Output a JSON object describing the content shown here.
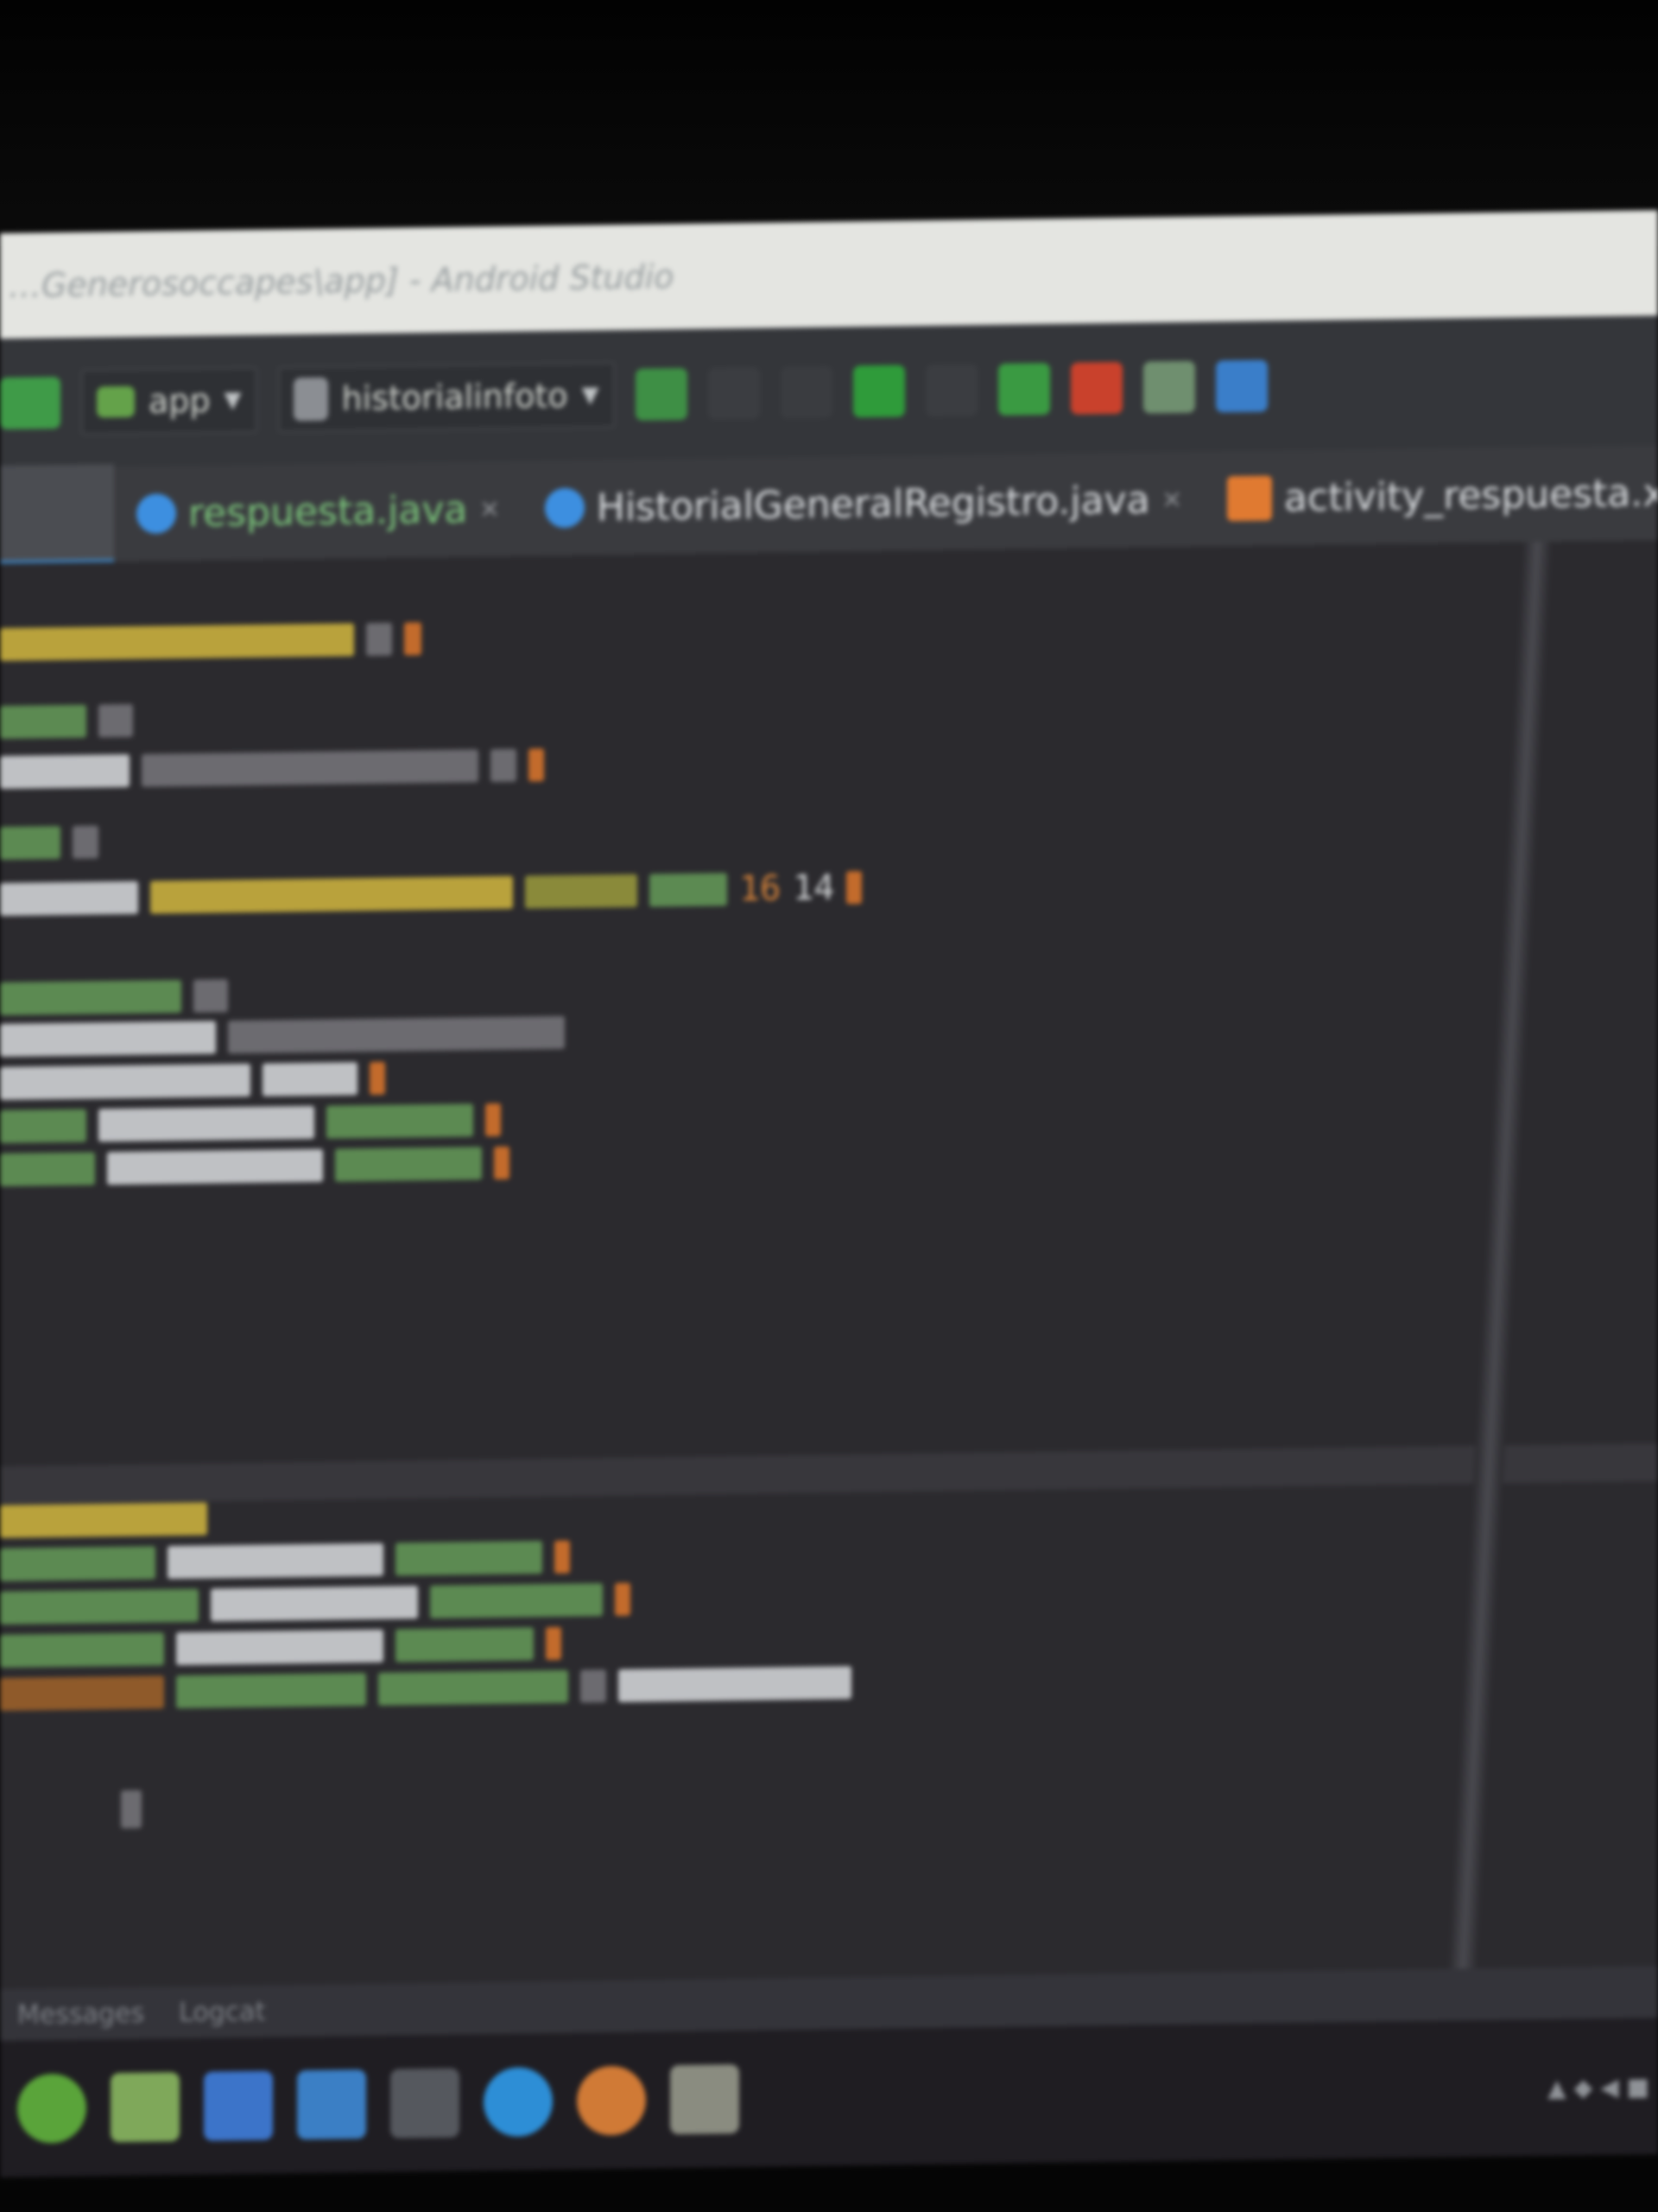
{
  "window": {
    "title": "…Generosoccapes\\app] - Android Studio"
  },
  "toolbar": {
    "module_selector": "app",
    "run_config_selector": "historialinfoto"
  },
  "tabs": [
    {
      "label": "respuesta.java",
      "icon": "java-class-icon",
      "active": false
    },
    {
      "label": "HistorialGeneralRegistro.java",
      "icon": "java-class-icon",
      "active": false
    },
    {
      "label": "activity_respuesta.xml",
      "icon": "xml-layout-icon",
      "active": false
    }
  ],
  "editor": {
    "note": "",
    "visible_numbers": [
      "16",
      "14"
    ]
  },
  "status": {
    "left": "Messages",
    "center": "Logcat"
  },
  "colors": {
    "editor_bg": "#2b2a2e",
    "title_bg": "#e4e5e1",
    "accent_tab": "#3b8fd9",
    "xml_icon": "#e07a31"
  }
}
